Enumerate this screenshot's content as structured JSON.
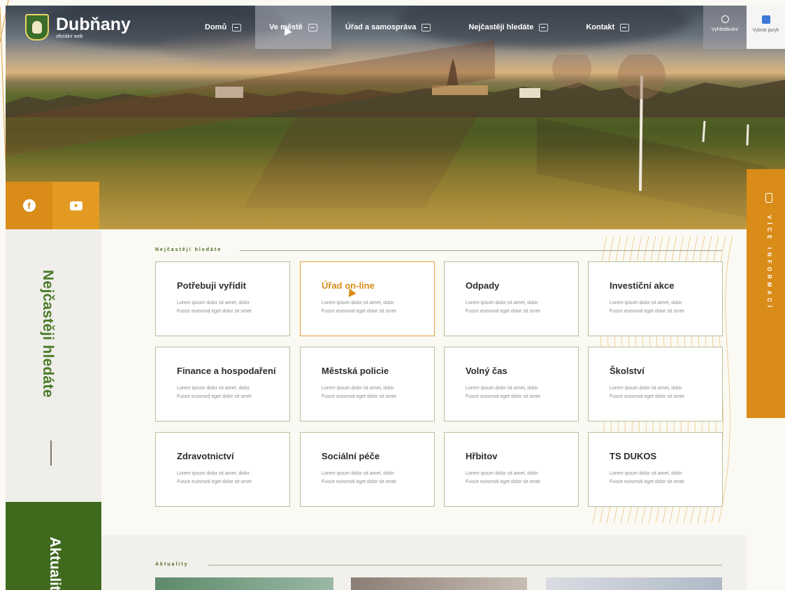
{
  "header": {
    "logo_title": "Dubňany",
    "logo_subtitle": "oficiální web",
    "menu": [
      {
        "label": "Domů",
        "active": false
      },
      {
        "label": "Ve městě",
        "active": true
      },
      {
        "label": "Úřad a samospráva",
        "active": false
      },
      {
        "label": "Nejčastěji hledáte",
        "active": false
      },
      {
        "label": "Kontakt",
        "active": false
      }
    ],
    "search_label": "Vyhledávání",
    "language_label": "Vybrat jazyk"
  },
  "socials": [
    {
      "name": "facebook-icon"
    },
    {
      "name": "youtube-icon"
    }
  ],
  "sidebar": {
    "section_title": "Nejčastěji hledáte",
    "next_section_title": "Aktuality"
  },
  "more_tab": {
    "label": "VÍCE INFORMACÍ"
  },
  "section": {
    "label": "Nejčastěji hledáte",
    "tiles": [
      {
        "title": "Potřebuji vyřídit",
        "desc_1": "Lorem ipsum dolor sit amet, dolor",
        "desc_2": "Fusce euismod eget dolor sit smet"
      },
      {
        "title": "Úřad on-line",
        "desc_1": "Lorem ipsum dolor sit amet, dolor",
        "desc_2": "Fusce euismod eget dolor sit smet"
      },
      {
        "title": "Odpady",
        "desc_1": "Lorem ipsum dolor sit amet, dolor",
        "desc_2": "Fusce euismod eget dolor sit smet"
      },
      {
        "title": "Investiční akce",
        "desc_1": "Lorem ipsum dolor sit amet, dolor",
        "desc_2": "Fusce euismod eget dolor sit smet"
      },
      {
        "title": "Finance a hospodaření",
        "desc_1": "Lorem ipsum dolor sit amet, dolor",
        "desc_2": "Fusce euismod eget dolor sit smet"
      },
      {
        "title": "Městská policie",
        "desc_1": "Lorem ipsum dolor sit amet, dolor",
        "desc_2": "Fusce euismod eget dolor sit smet"
      },
      {
        "title": "Volný čas",
        "desc_1": "Lorem ipsum dolor sit amet, dolor",
        "desc_2": "Fusce euismod eget dolor sit smet"
      },
      {
        "title": "Školství",
        "desc_1": "Lorem ipsum dolor sit amet, dolor",
        "desc_2": "Fusce euismod eget dolor sit smet"
      },
      {
        "title": "Zdravotnictví",
        "desc_1": "Lorem ipsum dolor sit amet, dolor",
        "desc_2": "Fusce euismod eget dolor sit smet"
      },
      {
        "title": "Sociální péče",
        "desc_1": "Lorem ipsum dolor sit amet, dolor",
        "desc_2": "Fusce euismod eget dolor sit smet"
      },
      {
        "title": "Hřbitov",
        "desc_1": "Lorem ipsum dolor sit amet, dolor",
        "desc_2": "Fusce euismod eget dolor sit smet"
      },
      {
        "title": "TS DUKOS",
        "desc_1": "Lorem ipsum dolor sit amet, dolor",
        "desc_2": "Fusce euismod eget dolor sit smet"
      }
    ]
  },
  "news": {
    "label": "Aktuality"
  },
  "colors": {
    "accent_orange": "#d98c18",
    "brand_green": "#3f6a1e",
    "text_dark": "#2c2c2c"
  }
}
